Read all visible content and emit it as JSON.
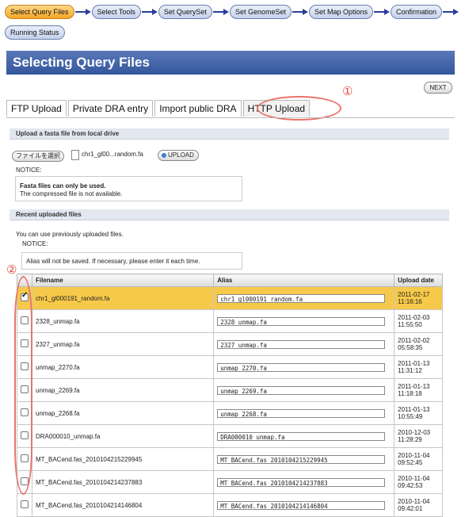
{
  "steps_row1": [
    "Select Query Files",
    "Select Tools",
    "Set QuerySet",
    "Set GenomeSet",
    "Set Map Options",
    "Confirmation"
  ],
  "steps_row2": [
    "Running Status"
  ],
  "colors": {
    "active_step": "#f4a623",
    "header": "#3b5da3",
    "annotation": "#e0483a",
    "selected_row": "#f7c94a"
  },
  "page_title": "Selecting Query Files",
  "next_label": "NEXT",
  "annotations": {
    "tab_marker": "①",
    "table_marker": "②"
  },
  "tabs": [
    "FTP Upload",
    "Private DRA entry",
    "Import public DRA",
    "HTTP Upload"
  ],
  "upload": {
    "section_title": "Upload a fasta file from local drive",
    "choose_label": "ファイルを選択",
    "file_name": "chr1_gl00...random.fa",
    "upload_label": "UPLOAD",
    "notice_label": "NOTICE:",
    "notice_bold": "Fasta files can only be used.",
    "notice_text": "The compressed file is not available."
  },
  "recent": {
    "section_title": "Recent uploaded files",
    "intro": "You can use previously uploaded files.",
    "notice_label": "NOTICE:",
    "notice_text": "Alias will not be saved. If necessary, please enter it each time."
  },
  "table": {
    "headers": {
      "filename": "Filename",
      "alias": "Alias",
      "date": "Upload date"
    },
    "rows": [
      {
        "filename": "chr1_gl000191_random.fa",
        "alias": "chr1_gl000191_random.fa",
        "date": "2011-02-17",
        "time": "11:16:16",
        "checked": true
      },
      {
        "filename": "2328_unmap.fa",
        "alias": "2328_unmap.fa",
        "date": "2011-02-03",
        "time": "11:55:50",
        "checked": false
      },
      {
        "filename": "2327_unmap.fa",
        "alias": "2327_unmap.fa",
        "date": "2011-02-02",
        "time": "05:58:35",
        "checked": false
      },
      {
        "filename": "unmap_2270.fa",
        "alias": "unmap_2270.fa",
        "date": "2011-01-13",
        "time": "11:31:12",
        "checked": false
      },
      {
        "filename": "unmap_2269.fa",
        "alias": "unmap_2269.fa",
        "date": "2011-01-13",
        "time": "11:18:18",
        "checked": false
      },
      {
        "filename": "unmap_2268.fa",
        "alias": "unmap_2268.fa",
        "date": "2011-01-13",
        "time": "10:55:49",
        "checked": false
      },
      {
        "filename": "DRA000010_unmap.fa",
        "alias": "DRA000010_unmap.fa",
        "date": "2010-12-03",
        "time": "11:28:29",
        "checked": false
      },
      {
        "filename": "MT_BACend.fas_2010104215229945",
        "alias": "MT_BACend.fas_2010104215229945",
        "date": "2010-11-04",
        "time": "09:52:45",
        "checked": false
      },
      {
        "filename": "MT_BACend.fas_2010104214237883",
        "alias": "MT_BACend.fas_2010104214237883",
        "date": "2010-11-04",
        "time": "09:42:53",
        "checked": false
      },
      {
        "filename": "MT_BACend.fas_2010104214146804",
        "alias": "MT_BACend.fas_2010104214146804",
        "date": "2010-11-04",
        "time": "09:42:01",
        "checked": false
      }
    ]
  }
}
